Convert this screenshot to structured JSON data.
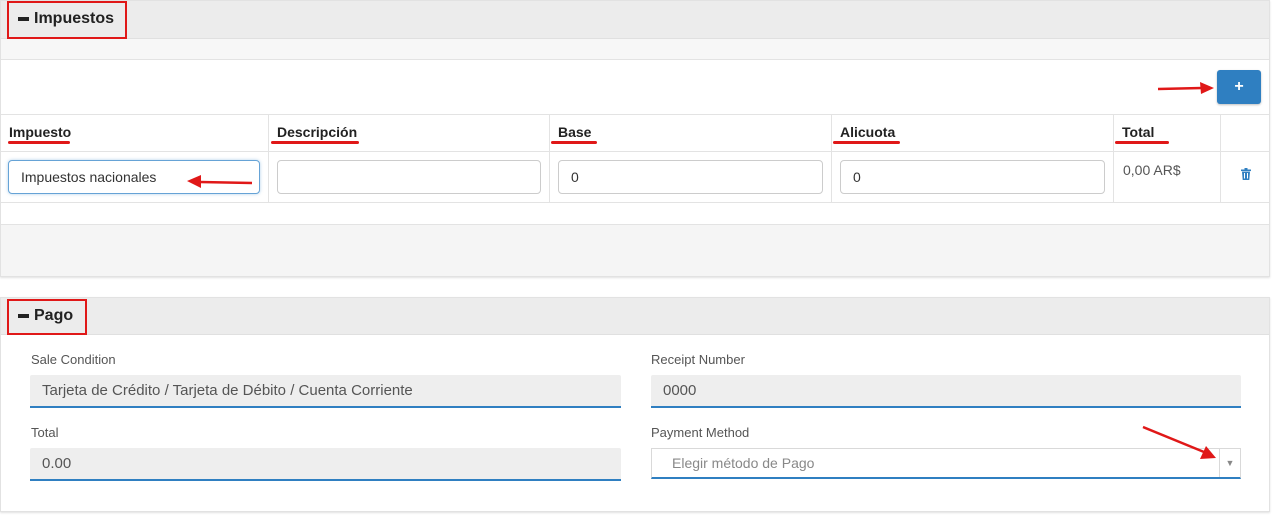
{
  "impuestos": {
    "title": "Impuestos",
    "add_label": "+",
    "columns": [
      "Impuesto",
      "Descripción",
      "Base",
      "Alicuota",
      "Total"
    ],
    "row": {
      "impuesto": "Impuestos nacionales",
      "descripcion": "",
      "base": "0",
      "alicuota": "0",
      "total": "0,00 AR$",
      "delete_icon": "trash-icon"
    }
  },
  "pago": {
    "title": "Pago",
    "sale_condition_label": "Sale Condition",
    "sale_condition_value": "Tarjeta de Crédito / Tarjeta de Débito / Cuenta Corriente",
    "receipt_number_label": "Receipt Number",
    "receipt_number_value": "0000",
    "total_label": "Total",
    "total_value": "0.00",
    "payment_method_label": "Payment Method",
    "payment_method_placeholder": "Elegir método de Pago"
  },
  "colors": {
    "accent": "#2f7fc1",
    "annotation": "#e01818",
    "header_bg": "#ececec"
  }
}
